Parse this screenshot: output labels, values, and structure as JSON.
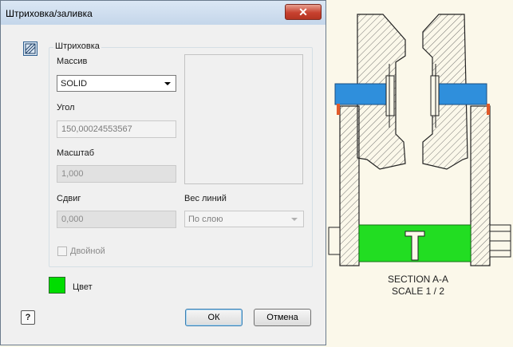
{
  "dialog": {
    "title": "Штриховка/заливка",
    "close_glyph": "✕",
    "group_title": "Штриховка",
    "pattern_label": "Массив",
    "pattern_value": "SOLID",
    "angle_label": "Угол",
    "angle_value": "150,00024553567",
    "scale_label": "Масштаб",
    "scale_value": "1,000",
    "offset_label": "Сдвиг",
    "offset_value": "0,000",
    "lineweight_label": "Вес линий",
    "lineweight_value": "По слою",
    "double_label": "Двойной",
    "color_label": "Цвет",
    "color_value": "#00dd00",
    "help_glyph": "?",
    "ok_label": "ОК",
    "cancel_label": "Отмена"
  },
  "drawing": {
    "section_title": "SECTION A-A",
    "scale_text": "SCALE 1 / 2",
    "colors": {
      "shaft": "#2f8fdc",
      "fill": "#22dd22",
      "pin": "#e25a2a",
      "background": "#fbf8ea"
    }
  }
}
